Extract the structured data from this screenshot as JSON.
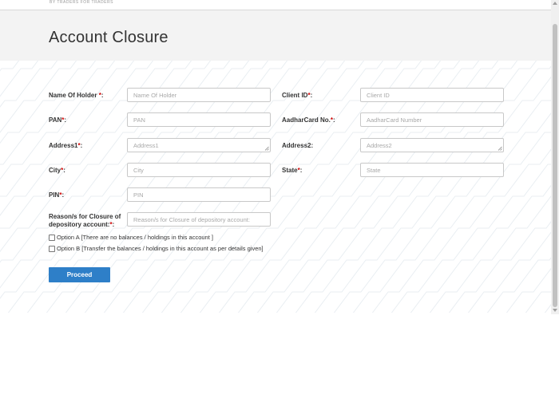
{
  "header": {
    "tagline": "BY TRADERS FOR TRADERS"
  },
  "page": {
    "title": "Account Closure"
  },
  "form": {
    "name_of_holder": {
      "label": "Name Of Holder ",
      "required": "*",
      "suffix": ":",
      "placeholder": "Name Of Holder"
    },
    "client_id": {
      "label": "Client ID",
      "required": "*",
      "suffix": ":",
      "placeholder": "Client ID"
    },
    "pan": {
      "label": "PAN",
      "required": "*",
      "suffix": ":",
      "placeholder": "PAN"
    },
    "aadhar": {
      "label": "AadharCard No.",
      "required": "*",
      "suffix": ":",
      "placeholder": "AadharCard Number"
    },
    "address1": {
      "label": "Address1",
      "required": "*",
      "suffix": ":",
      "placeholder": "Address1"
    },
    "address2": {
      "label": "Address2:",
      "placeholder": "Address2"
    },
    "city": {
      "label": "City",
      "required": "*",
      "suffix": ":",
      "placeholder": "City"
    },
    "state": {
      "label": "State",
      "required": "*",
      "suffix": ":",
      "placeholder": "State"
    },
    "pin": {
      "label": "PIN",
      "required": "*",
      "suffix": ":",
      "placeholder": "PIN"
    },
    "reason": {
      "label_line1": "Reason/s for Closure of",
      "label_line2": "depository account:",
      "required": "*",
      "suffix": ":",
      "placeholder": "Reason/s for Closure of depository account:"
    },
    "option_a": {
      "label": "Option A [There are no balances / holdings in this account ]",
      "checked": false
    },
    "option_b": {
      "label": "Option B [Transfer the balances / holdings in this account as per details given]",
      "checked": false
    },
    "proceed_label": "Proceed"
  },
  "colors": {
    "accent": "#2e7fc8",
    "required": "#cc0000",
    "hero_bg": "#f3f3f3"
  }
}
